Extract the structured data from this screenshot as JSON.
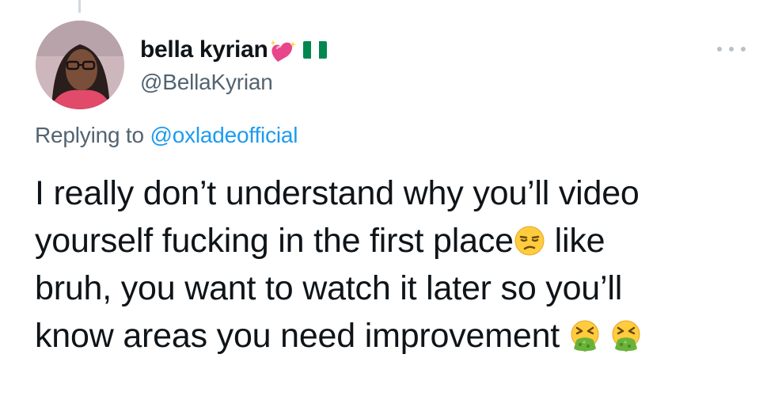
{
  "tweet": {
    "display_name": "bella kyrian",
    "handle": "@BellaKyrian",
    "name_emoji": "sparkling-heart-icon",
    "name_flag": "nigeria-flag-icon",
    "flag_colors": [
      "#008751",
      "#ffffff",
      "#008751"
    ],
    "reply_prefix": "Replying to",
    "reply_to": "@oxladeofficial",
    "more_icon": "more-options-icon",
    "text_lines": [
      {
        "before": "I really don’t understand why you’ll video",
        "emojis": [],
        "after": ""
      },
      {
        "before": "yourself fucking in the first place",
        "emojis": [
          "unamused-face-icon"
        ],
        "after": " like"
      },
      {
        "before": "bruh, you want to watch it later so you’ll",
        "emojis": [],
        "after": ""
      },
      {
        "before": "know areas you need improvement ",
        "emojis": [
          "face-vomiting-icon",
          "face-vomiting-icon"
        ],
        "after": ""
      }
    ]
  },
  "colors": {
    "text": "#0f1419",
    "secondary": "#536471",
    "link": "#1d9bf0",
    "thread_line": "#cfd9de"
  }
}
